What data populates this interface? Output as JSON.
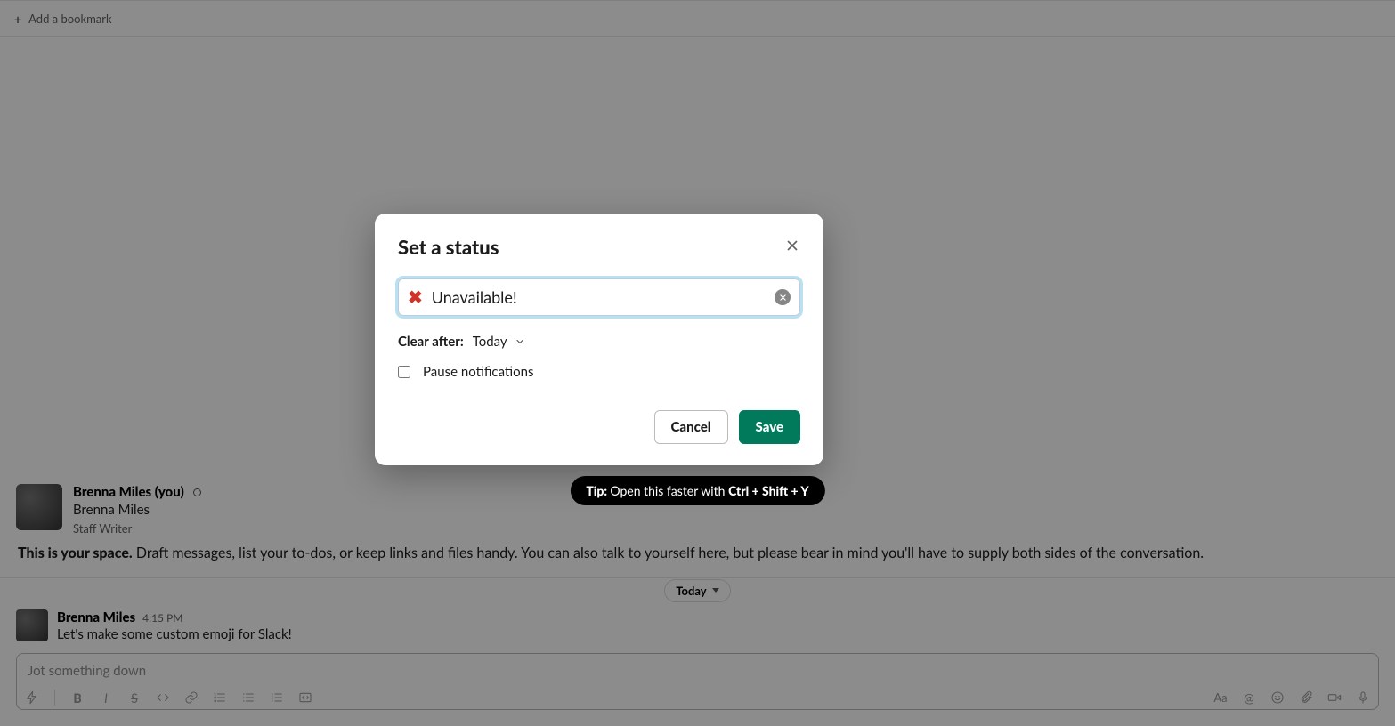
{
  "bookmark": {
    "label": "Add a bookmark"
  },
  "user": {
    "display_name": "Brenna Miles (you)",
    "real_name": "Brenna Miles",
    "title": "Staff Writer"
  },
  "space": {
    "bold": "This is your space.",
    "rest": " Draft messages, list your to-dos, or keep links and files handy. You can also talk to yourself here, but please bear in mind you'll have to supply both sides of the conversation."
  },
  "divider_date": "Today",
  "message": {
    "author": "Brenna Miles",
    "ts": "4:15 PM",
    "text": "Let's make some custom emoji for Slack!"
  },
  "composer": {
    "placeholder": "Jot something down"
  },
  "modal": {
    "title": "Set a status",
    "status_value": "Unavailable!",
    "status_emoji": "✖",
    "clear_after_label": "Clear after:",
    "clear_after_value": "Today",
    "pause_label": "Pause notifications",
    "save": "Save",
    "cancel": "Cancel"
  },
  "tip": {
    "prefix": "Tip: ",
    "text": "Open this faster with ",
    "shortcut": "Ctrl + Shift + Y"
  }
}
